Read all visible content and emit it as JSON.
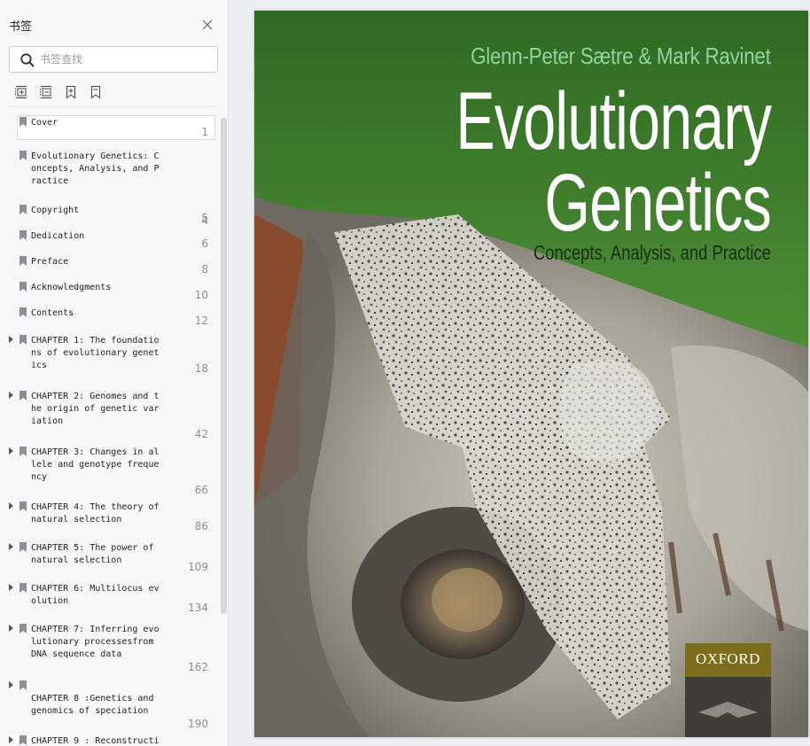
{
  "sidebar": {
    "title": "书签",
    "search_placeholder": "书签查找",
    "tools": [
      "expand-all-icon",
      "collapse-all-icon",
      "add-bookmark-icon",
      "bookmark-icon"
    ],
    "bookmarks": [
      {
        "label": "Cover",
        "page": "1",
        "expandable": false,
        "selected": true
      },
      {
        "label": "Evolutionary Genetics: C\noncepts, Analysis, and P\nractice",
        "page": "4",
        "expandable": false
      },
      {
        "label": "Copyright",
        "page": "5",
        "expandable": false
      },
      {
        "label": "Dedication",
        "page": "6",
        "expandable": false
      },
      {
        "label": "Preface",
        "page": "8",
        "expandable": false
      },
      {
        "label": "Acknowledgments",
        "page": "10",
        "expandable": false
      },
      {
        "label": "Contents",
        "page": "12",
        "expandable": false
      },
      {
        "label": "CHAPTER 1: The foundatio\nns of evolutionary genet\nics",
        "page": "18",
        "expandable": true
      },
      {
        "label": "CHAPTER 2: Genomes and t\nhe origin of genetic var\niation",
        "page": "42",
        "expandable": true
      },
      {
        "label": "CHAPTER 3: Changes in al\nlele and genotype freque\nncy",
        "page": "66",
        "expandable": true
      },
      {
        "label": "CHAPTER 4: The theory of\nnatural selection",
        "page": "86",
        "expandable": true
      },
      {
        "label": "CHAPTER 5: The power of\nnatural selection",
        "page": "109",
        "expandable": true
      },
      {
        "label": "CHAPTER 6: Multilocus ev\nolution",
        "page": "134",
        "expandable": true
      },
      {
        "label": "CHAPTER 7: Inferring evo\nlutionary processesfrom\nDNA sequence data",
        "page": "162",
        "expandable": true
      },
      {
        "label": "\nCHAPTER 8 :Genetics and\ngenomics of speciation",
        "page": "190",
        "expandable": true
      },
      {
        "label": "CHAPTER 9 : Reconstructi",
        "page": "",
        "expandable": true
      }
    ]
  },
  "cover": {
    "authors": "Glenn-Peter Sætre & Mark Ravinet",
    "title_line1": "Evolutionary",
    "title_line2": "Genetics",
    "subtitle": "Concepts, Analysis, and Practice",
    "publisher": "OXFORD",
    "colors": {
      "background": "#3f7a2e",
      "authors": "#8fd49c",
      "title": "#ffffff",
      "publisher_bar": "#7b6d1c"
    }
  }
}
